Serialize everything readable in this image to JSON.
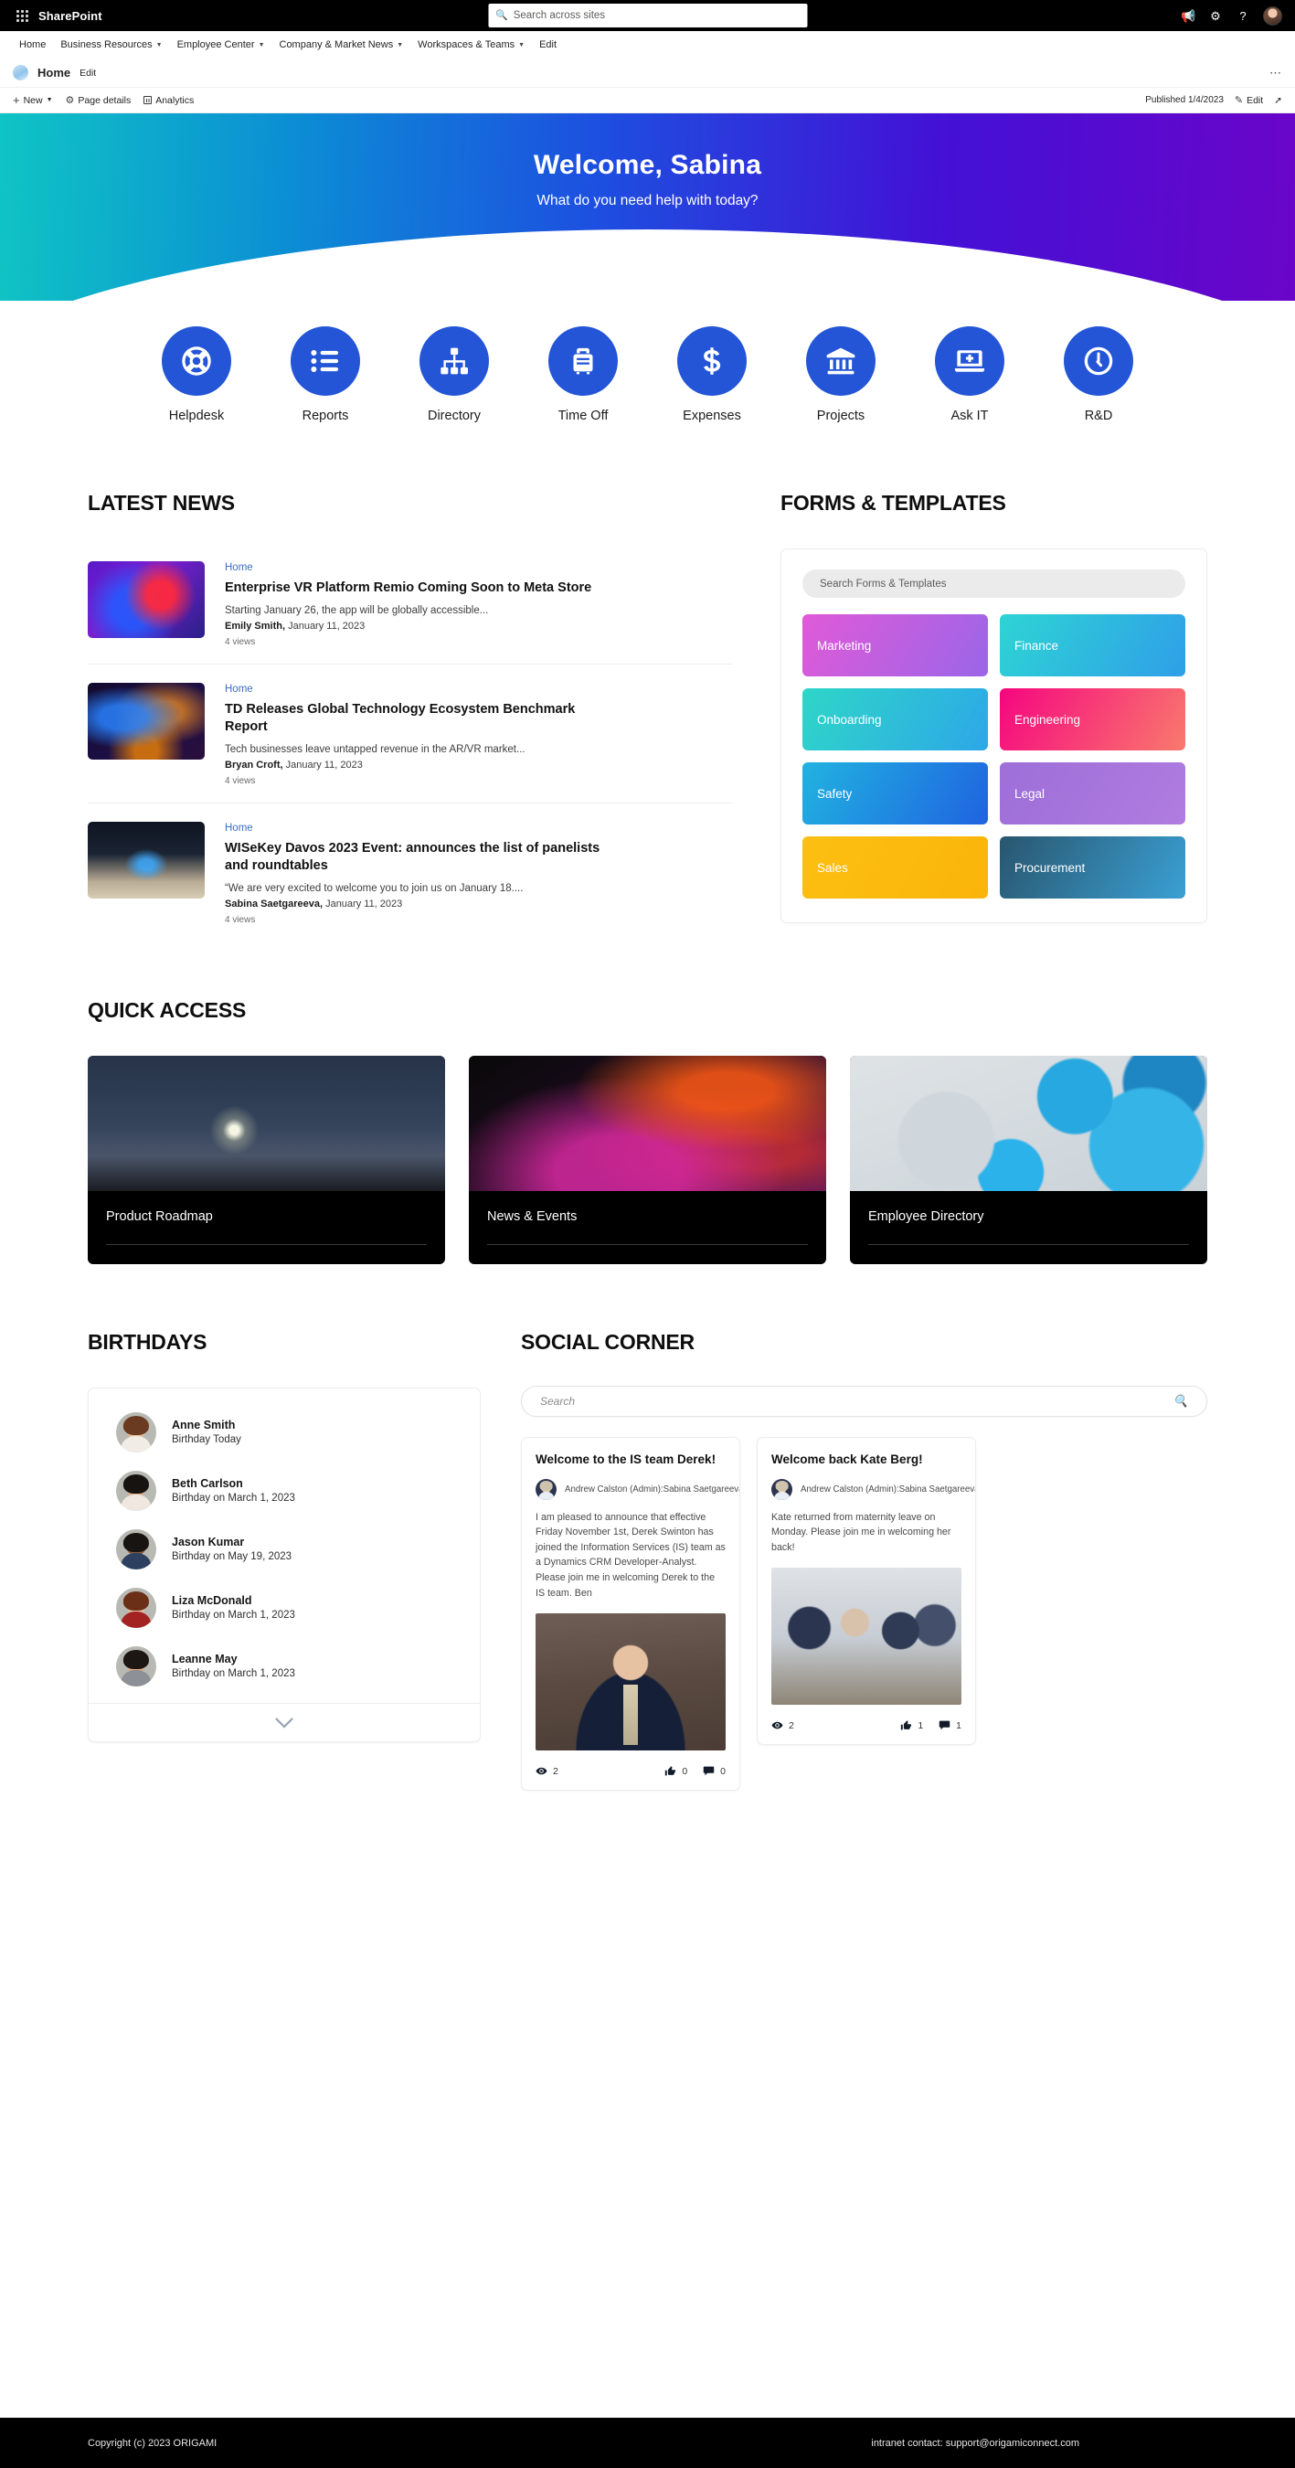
{
  "suitebar": {
    "brand": "SharePoint",
    "search_placeholder": "Search across sites",
    "waffle_icon": "app-launcher-icon",
    "megaphone_icon": "megaphone-icon",
    "settings_icon": "gear-icon",
    "help_icon": "help-icon",
    "avatar": "user-avatar"
  },
  "sitenav": {
    "items": [
      {
        "label": "Home",
        "has_chevron": false
      },
      {
        "label": "Business Resources",
        "has_chevron": true
      },
      {
        "label": "Employee Center",
        "has_chevron": true
      },
      {
        "label": "Company & Market News",
        "has_chevron": true
      },
      {
        "label": "Workspaces & Teams",
        "has_chevron": true
      },
      {
        "label": "Edit",
        "has_chevron": false
      }
    ]
  },
  "siteheader": {
    "title": "Home",
    "edit_label": "Edit",
    "more_label": "⋯"
  },
  "commandbar": {
    "new_label": "New",
    "page_details_label": "Page details",
    "analytics_label": "Analytics",
    "published_label": "Published 1/4/2023",
    "edit_label": "Edit"
  },
  "hero": {
    "title": "Welcome, Sabina",
    "subtitle": "What do you need help with today?",
    "gradient_from": "#0fc4c4",
    "gradient_to": "#6a05c9"
  },
  "quicklinks": {
    "accent": "#2355d6",
    "items": [
      {
        "label": "Helpdesk",
        "icon": "lifebuoy-icon"
      },
      {
        "label": "Reports",
        "icon": "list-icon"
      },
      {
        "label": "Directory",
        "icon": "org-chart-icon"
      },
      {
        "label": "Time Off",
        "icon": "suitcase-icon"
      },
      {
        "label": "Expenses",
        "icon": "dollar-icon"
      },
      {
        "label": "Projects",
        "icon": "bank-icon"
      },
      {
        "label": "Ask IT",
        "icon": "laptop-plus-icon"
      },
      {
        "label": "R&D",
        "icon": "clock-icon"
      }
    ]
  },
  "news": {
    "heading": "LATEST NEWS",
    "items": [
      {
        "site": "Home",
        "title": "Enterprise VR Platform Remio Coming Soon to Meta Store",
        "description": "Starting January 26, the app will be globally accessible...",
        "author": "Emily Smith,",
        "date": " January 11, 2023",
        "views": "4 views",
        "thumb": "vr-headset-photo"
      },
      {
        "site": "Home",
        "title": "TD Releases Global Technology Ecosystem Benchmark Report",
        "description": "Tech businesses leave untapped revenue in the AR/VR market...",
        "author": "Bryan Croft,",
        "date": " January 11, 2023",
        "views": "4 views",
        "thumb": "neon-hands-photo"
      },
      {
        "site": "Home",
        "title": "WISeKey Davos 2023 Event: announces the list of panelists and roundtables",
        "description": "“We are very excited to welcome you to join us on January 18....",
        "author": "Sabina Saetgareeva,",
        "date": " January 11, 2023",
        "views": "4 views",
        "thumb": "conference-hall-photo"
      }
    ]
  },
  "forms": {
    "heading": "FORMS & TEMPLATES",
    "search_placeholder": "Search Forms & Templates",
    "tiles": [
      {
        "label": "Marketing",
        "from": "#e05ad8",
        "to": "#9a66e8"
      },
      {
        "label": "Finance",
        "from": "#2ed4d4",
        "to": "#2f9fe8"
      },
      {
        "label": "Onboarding",
        "from": "#2ed6c8",
        "to": "#2da7e8"
      },
      {
        "label": "Engineering",
        "from": "#f5067f",
        "to": "#f97a6d"
      },
      {
        "label": "Safety",
        "from": "#21b3e0",
        "to": "#1f63e0"
      },
      {
        "label": "Legal",
        "from": "#9d6fd8",
        "to": "#b07ce0"
      },
      {
        "label": "Sales",
        "from": "#fcbf12",
        "to": "#fbb40a"
      },
      {
        "label": "Procurement",
        "from": "#29566e",
        "to": "#3aa0d4"
      }
    ]
  },
  "quickaccess": {
    "heading": "QUICK ACCESS",
    "cards": [
      {
        "title": "Product Roadmap",
        "image": "lighthouse-night-photo"
      },
      {
        "title": "News & Events",
        "image": "laptop-neon-photo"
      },
      {
        "title": "Employee Directory",
        "image": "blue-spheres-photo"
      }
    ]
  },
  "birthdays": {
    "heading": "BIRTHDAYS",
    "expand_icon": "chevron-down-icon",
    "items": [
      {
        "name": "Anne Smith",
        "note": "Birthday Today",
        "avatar": "anne-smith-avatar"
      },
      {
        "name": "Beth Carlson",
        "note": "Birthday on March 1, 2023",
        "avatar": "beth-carlson-avatar"
      },
      {
        "name": "Jason Kumar",
        "note": "Birthday on May 19, 2023",
        "avatar": "jason-kumar-avatar"
      },
      {
        "name": "Liza McDonald",
        "note": "Birthday on March 1, 2023",
        "avatar": "liza-mcdonald-avatar"
      },
      {
        "name": "Leanne May",
        "note": "Birthday on March 1, 2023",
        "avatar": "leanne-may-avatar"
      }
    ]
  },
  "social": {
    "heading": "SOCIAL CORNER",
    "search_placeholder": "Search",
    "search_icon": "search-icon",
    "posts": [
      {
        "title": "Welcome to the IS team Derek!",
        "author": "Andrew Calston (Admin):Sabina Saetgareeva",
        "body": "I am pleased to announce that effective Friday November 1st, Derek Swinton has joined the Information Services (IS) team as a Dynamics CRM Developer-Analyst. Please join me in welcoming Derek to the IS team. Ben",
        "image": "derek-portrait-photo",
        "views": "2",
        "likes": "0",
        "comments": "0"
      },
      {
        "title": "Welcome back Kate Berg!",
        "author": "Andrew Calston (Admin):Sabina Saetgareeva",
        "body": "Kate returned from maternity leave on Monday. Please join me in welcoming her back!",
        "image": "team-group-photo",
        "views": "2",
        "likes": "1",
        "comments": "1"
      }
    ]
  },
  "footer": {
    "copyright": "Copyright (c) 2023 ORIGAMI",
    "contact": "intranet contact: support@origamiconnect.com"
  }
}
